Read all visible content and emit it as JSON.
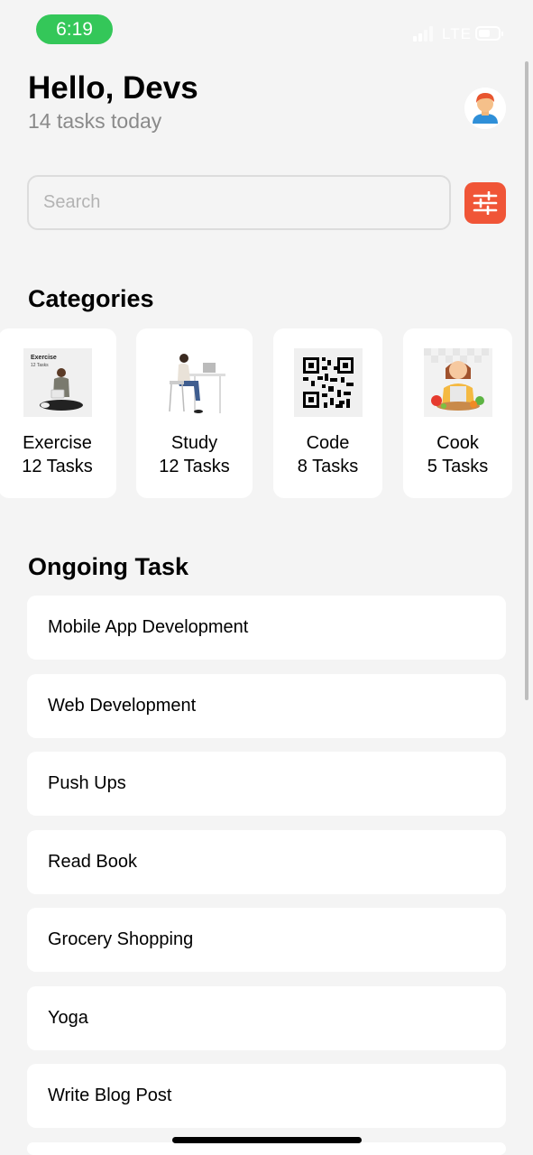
{
  "status_bar": {
    "time": "6:19",
    "network": "LTE"
  },
  "header": {
    "greeting": "Hello, Devs",
    "subtitle": "14 tasks today"
  },
  "search": {
    "placeholder": "Search"
  },
  "categories": {
    "title": "Categories",
    "items": [
      {
        "name": "Exercise",
        "count": "12 Tasks",
        "thumb_title": "Exercise",
        "thumb_sub": "12 Tasks"
      },
      {
        "name": "Study",
        "count": "12 Tasks"
      },
      {
        "name": "Code",
        "count": "8 Tasks"
      },
      {
        "name": "Cook",
        "count": "5 Tasks"
      }
    ]
  },
  "ongoing": {
    "title": "Ongoing Task",
    "items": [
      "Mobile App Development",
      "Web Development",
      "Push Ups",
      "Read Book",
      "Grocery Shopping",
      "Yoga",
      "Write Blog Post"
    ]
  },
  "colors": {
    "accent": "#f05537",
    "time_pill": "#34c759",
    "background": "#f4f4f4"
  },
  "icons": {
    "avatar": "user-avatar-icon",
    "filter": "sliders-icon"
  }
}
